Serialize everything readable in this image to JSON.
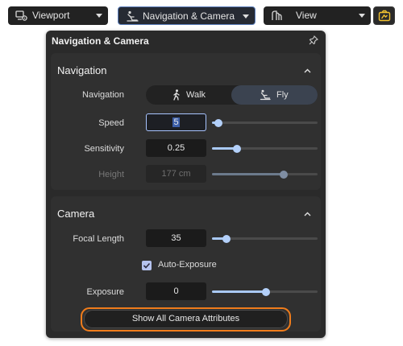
{
  "toolbar": {
    "viewport": {
      "label": "Viewport",
      "icon": "viewport-settings-icon"
    },
    "navigation_camera": {
      "label": "Navigation & Camera",
      "icon": "fly-navigation-icon"
    },
    "view": {
      "label": "View",
      "icon": "view-layout-icon"
    },
    "camera_toggle": {
      "icon": "camera-settings-icon",
      "color": "#f2c230"
    }
  },
  "panel": {
    "title": "Navigation & Camera",
    "pin_icon": "pin-icon",
    "navigation_section": {
      "title": "Navigation",
      "navigation": {
        "label": "Navigation",
        "options": [
          "Walk",
          "Fly"
        ],
        "selected": "Fly"
      },
      "speed": {
        "label": "Speed",
        "value": "5",
        "slider_fraction": 0.06
      },
      "sensitivity": {
        "label": "Sensitivity",
        "value": "0.25",
        "slider_fraction": 0.24
      },
      "height": {
        "label": "Height",
        "value": "177 cm",
        "slider_fraction": 0.68,
        "disabled": true
      }
    },
    "camera_section": {
      "title": "Camera",
      "focal_length": {
        "label": "Focal Length",
        "value": "35",
        "slider_fraction": 0.14
      },
      "auto_exposure": {
        "label": "Auto-Exposure",
        "checked": true
      },
      "exposure": {
        "label": "Exposure",
        "value": "0",
        "slider_fraction": 0.51
      }
    },
    "show_all_button": {
      "label": "Show All Camera Attributes",
      "highlight_color": "#f07c1b"
    }
  },
  "colors": {
    "accent": "#a9c9f5",
    "panel_bg": "#2a2a2a",
    "section_bg": "#303030"
  }
}
